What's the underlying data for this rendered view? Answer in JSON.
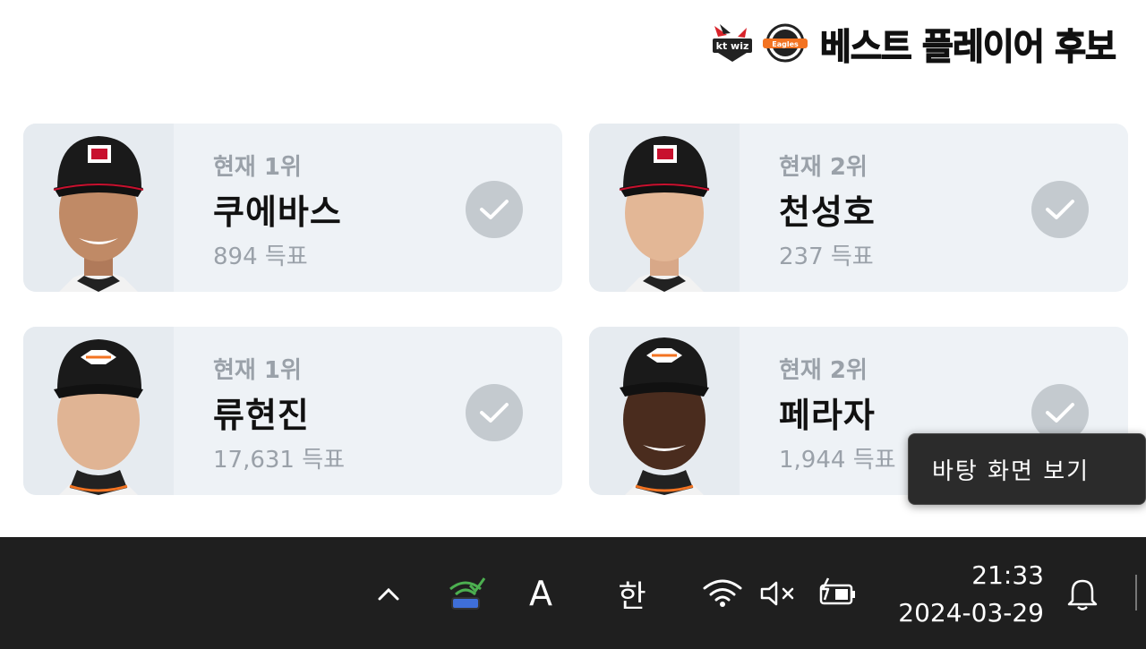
{
  "header": {
    "title": "베스트 플레이어 후보",
    "logo_kt_icon": "kt-wiz-logo-icon",
    "logo_hanwha_icon": "hanwha-eagles-logo-icon"
  },
  "candidates": [
    {
      "rank": "현재 1위",
      "name": "쿠에바스",
      "votes": "894 득표",
      "cap_color": "#1a1a1a"
    },
    {
      "rank": "현재 2위",
      "name": "천성호",
      "votes": "237 득표",
      "cap_color": "#1a1a1a"
    },
    {
      "rank": "현재 1위",
      "name": "류현진",
      "votes": "17,631 득표",
      "cap_color": "#1a1a1a"
    },
    {
      "rank": "현재 2위",
      "name": "페라자",
      "votes": "1,944 득표",
      "cap_color": "#1a1a1a"
    }
  ],
  "tooltip": {
    "text": "바탕 화면 보기"
  },
  "taskbar": {
    "chevron_icon": "chevron-up-icon",
    "network_app_icon": "network-status-icon",
    "ime_mode": "A",
    "ime_lang": "한",
    "wifi_icon": "wifi-icon",
    "volume_icon": "volume-muted-icon",
    "battery_icon": "battery-charging-icon",
    "time": "21:33",
    "date": "2024-03-29",
    "bell_icon": "notification-bell-icon"
  },
  "colors": {
    "card_bg": "#eef2f6",
    "muted_text": "#9aa1a9",
    "check_bg": "#c4cacf",
    "taskbar_bg": "#1f1f1f"
  }
}
